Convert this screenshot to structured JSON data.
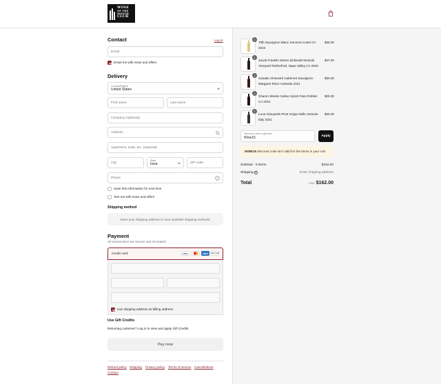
{
  "brand": {
    "logo_lines": [
      "WINE",
      "OF THE",
      "MONTH",
      "CLUB"
    ]
  },
  "contact": {
    "title": "Contact",
    "login_link": "Log in",
    "email_placeholder": "Email",
    "email_offers_label": "Email me with news and offers",
    "email_offers_checked": true
  },
  "delivery": {
    "title": "Delivery",
    "country_label": "Country/Region",
    "country_value": "United States",
    "first_name": "First name",
    "last_name": "Last name",
    "company": "Company (optional)",
    "address": "Address",
    "apartment": "Apartment, suite, etc. (optional)",
    "city": "City",
    "state_label": "State",
    "state_value": "Iowa",
    "zip": "ZIP code",
    "phone": "Phone",
    "save_info_label": "Save this information for next time",
    "text_offers_label": "Text me with news and offers"
  },
  "shipping_method": {
    "title": "Shipping method",
    "notice": "Enter your shipping address to view available shipping methods."
  },
  "payment": {
    "title": "Payment",
    "subtitle": "All transactions are secure and encrypted.",
    "credit_card_label": "Credit card",
    "card_brands": [
      "VISA",
      "MC",
      "AMEX",
      "DISCOVER"
    ],
    "billing_label": "Use shipping address as billing address"
  },
  "gift_credits": {
    "title": "Use Gift Credits",
    "text": "Returning customer? Log in to view and apply Gift Credits"
  },
  "pay_button": "Pay now",
  "footer_links": [
    "Refund policy",
    "Shipping",
    "Privacy policy",
    "Terms of service",
    "Cancellations",
    "Contact"
  ],
  "cart": {
    "items": [
      {
        "qty": "1",
        "name": "Tilth Sauvignon Blanc Sonoma Coast CA 2023",
        "price": "$35.00",
        "bottle_color": "#d8c98a"
      },
      {
        "qty": "1",
        "name": "Jacob Franklin Wines Zinfandel Morisoli Vineyard Rutherford, Napa Valley CA 2020",
        "price": "$47.00",
        "bottle_color": "#2a1c1c"
      },
      {
        "qty": "1",
        "name": "Xanadu Vinework Cabernet Sauvignon Margaret River Australia 2021",
        "price": "$30.00",
        "bottle_color": "#3a1a1a"
      },
      {
        "qty": "1",
        "name": "Sharon Weeks Cattoo Syrah Paso Robles CA 2021",
        "price": "$25.00",
        "bottle_color": "#241414"
      },
      {
        "qty": "1",
        "name": "Luna Vineyards Pinot Grigio Delle Venezie Italy 2021",
        "price": "$25.00",
        "bottle_color": "#30352a"
      }
    ],
    "discount_label": "Discount code or gift card",
    "discount_value": "Wine15",
    "apply_label": "Apply",
    "warning_code": "WINE15",
    "warning_text": "discount code isn't valid for the items in your cart",
    "subtotal_label": "Subtotal · 5 items",
    "subtotal_value": "$162.00",
    "shipping_label": "Shipping",
    "shipping_value": "Enter shipping address",
    "total_label": "Total",
    "total_currency": "USD",
    "total_value": "$162.00"
  }
}
